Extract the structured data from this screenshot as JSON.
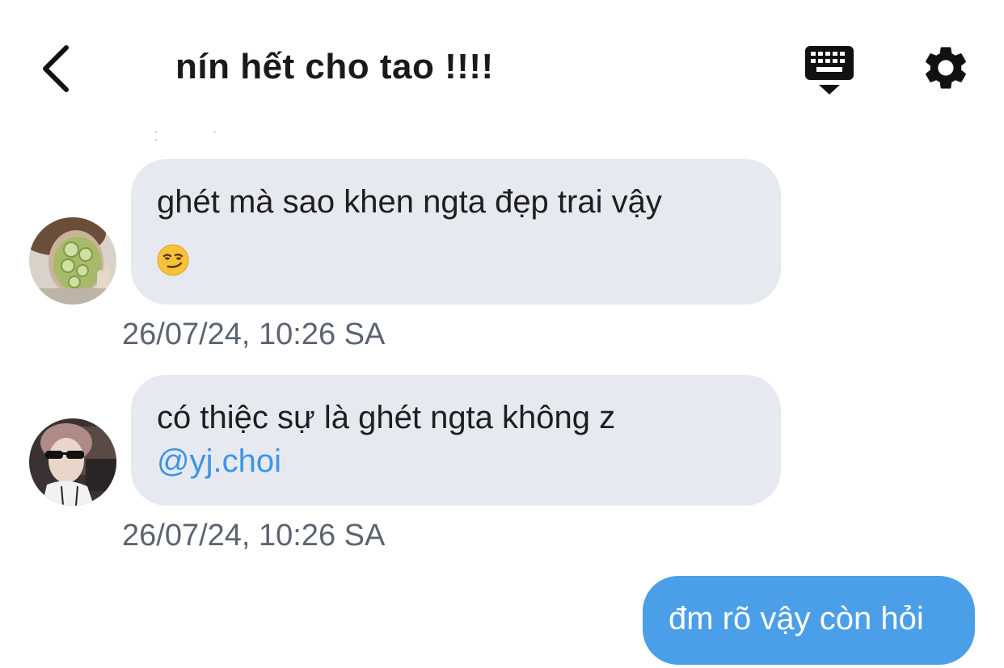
{
  "header": {
    "title": "nín hết cho tao !!!!",
    "back_icon": "chevron-left-icon",
    "keyboard_icon": "keyboard-icon",
    "settings_icon": "gear-icon"
  },
  "messages": [
    {
      "direction": "incoming",
      "avatar": "user-avatar-cucumber-mask",
      "text": "ghét mà sao khen ngta đẹp trai vậy",
      "emoji": "😏",
      "timestamp": "26/07/24, 10:26 SA"
    },
    {
      "direction": "incoming",
      "avatar": "user-avatar-sunglasses",
      "text": "có thiệc sự là ghét ngta không z",
      "mention": "@yj.choi",
      "timestamp": "26/07/24, 10:26 SA"
    },
    {
      "direction": "outgoing",
      "text": "đm rõ vậy còn hỏi"
    }
  ],
  "colors": {
    "incoming_bubble": "#e6e9ef",
    "outgoing_bubble": "#4a9fe8",
    "mention": "#3d95e6",
    "timestamp": "#5b6470"
  }
}
